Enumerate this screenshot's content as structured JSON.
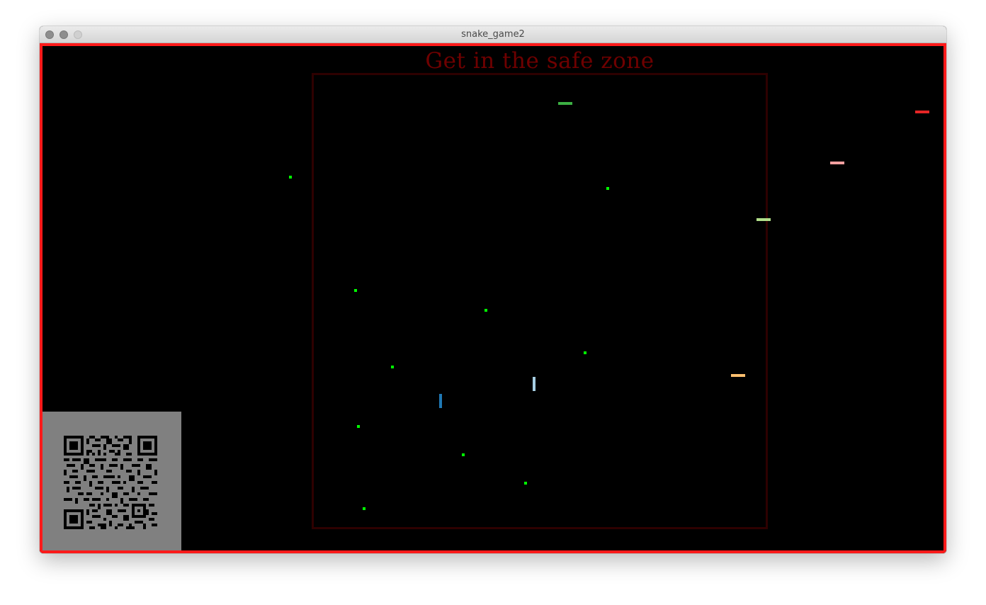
{
  "window": {
    "title": "snake_game2"
  },
  "game": {
    "message": "Get in the safe zone",
    "colors": {
      "border": "#ff1a1a",
      "safe_zone_border": "#2e0000",
      "message": "#6e0000",
      "food": "#00ff00",
      "qr_background": "#808080"
    },
    "food_count": 11,
    "snakes": [
      {
        "name": "green-snake",
        "color": "#3cb043",
        "orientation": "horizontal"
      },
      {
        "name": "red-snake",
        "color": "#e52525",
        "orientation": "horizontal"
      },
      {
        "name": "pink-snake",
        "color": "#f4a0a0",
        "orientation": "horizontal"
      },
      {
        "name": "lightgreen-snake",
        "color": "#b2df8a",
        "orientation": "horizontal"
      },
      {
        "name": "orange-snake",
        "color": "#fdbf6f",
        "orientation": "horizontal"
      },
      {
        "name": "lightblue-snake",
        "color": "#a6cee3",
        "orientation": "vertical"
      },
      {
        "name": "blue-snake",
        "color": "#1f78b4",
        "orientation": "vertical"
      }
    ],
    "qr_code": {
      "icon": "qr-code-icon"
    }
  }
}
